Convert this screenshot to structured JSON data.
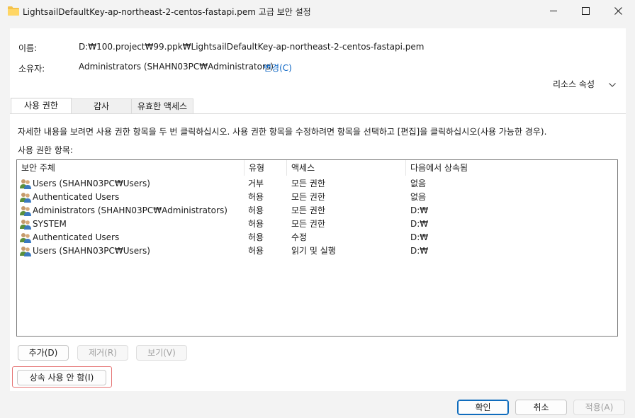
{
  "window": {
    "title": "LightsailDefaultKey-ap-northeast-2-centos-fastapi.pem 고급 보안 설정"
  },
  "info": {
    "name_label": "이름:",
    "name_value": "D:₩100.project₩99.ppk₩LightsailDefaultKey-ap-northeast-2-centos-fastapi.pem",
    "owner_label": "소유자:",
    "owner_value": "Administrators (SHAHN03PC₩Administrators)",
    "change_link": "변경(C)",
    "resource_properties": "리소스 속성"
  },
  "tabs": [
    {
      "label": "사용 권한",
      "active": true
    },
    {
      "label": "감사",
      "active": false
    },
    {
      "label": "유효한 액세스",
      "active": false
    }
  ],
  "permissions": {
    "instruction": "자세한 내용을 보려면 사용 권한 항목을 두 번 클릭하십시오. 사용 권한 항목을 수정하려면 항목을 선택하고 [편집]을 클릭하십시오(사용 가능한 경우).",
    "entries_label": "사용 권한 항목:",
    "columns": [
      "보안 주체",
      "유형",
      "액세스",
      "다음에서 상속됨"
    ],
    "rows": [
      {
        "principal": "Users (SHAHN03PC₩Users)",
        "type": "거부",
        "access": "모든 권한",
        "inherited": "없음"
      },
      {
        "principal": "Authenticated Users",
        "type": "허용",
        "access": "모든 권한",
        "inherited": "없음"
      },
      {
        "principal": "Administrators (SHAHN03PC₩Administrators)",
        "type": "허용",
        "access": "모든 권한",
        "inherited": "D:₩"
      },
      {
        "principal": "SYSTEM",
        "type": "허용",
        "access": "모든 권한",
        "inherited": "D:₩"
      },
      {
        "principal": "Authenticated Users",
        "type": "허용",
        "access": "수정",
        "inherited": "D:₩"
      },
      {
        "principal": "Users (SHAHN03PC₩Users)",
        "type": "허용",
        "access": "읽기 및 실행",
        "inherited": "D:₩"
      }
    ],
    "buttons": {
      "add": "추가(D)",
      "remove": "제거(R)",
      "view": "보기(V)"
    },
    "disable_inheritance": "상속 사용 안 함(I)"
  },
  "footer": {
    "ok": "확인",
    "cancel": "취소",
    "apply": "적용(A)"
  }
}
